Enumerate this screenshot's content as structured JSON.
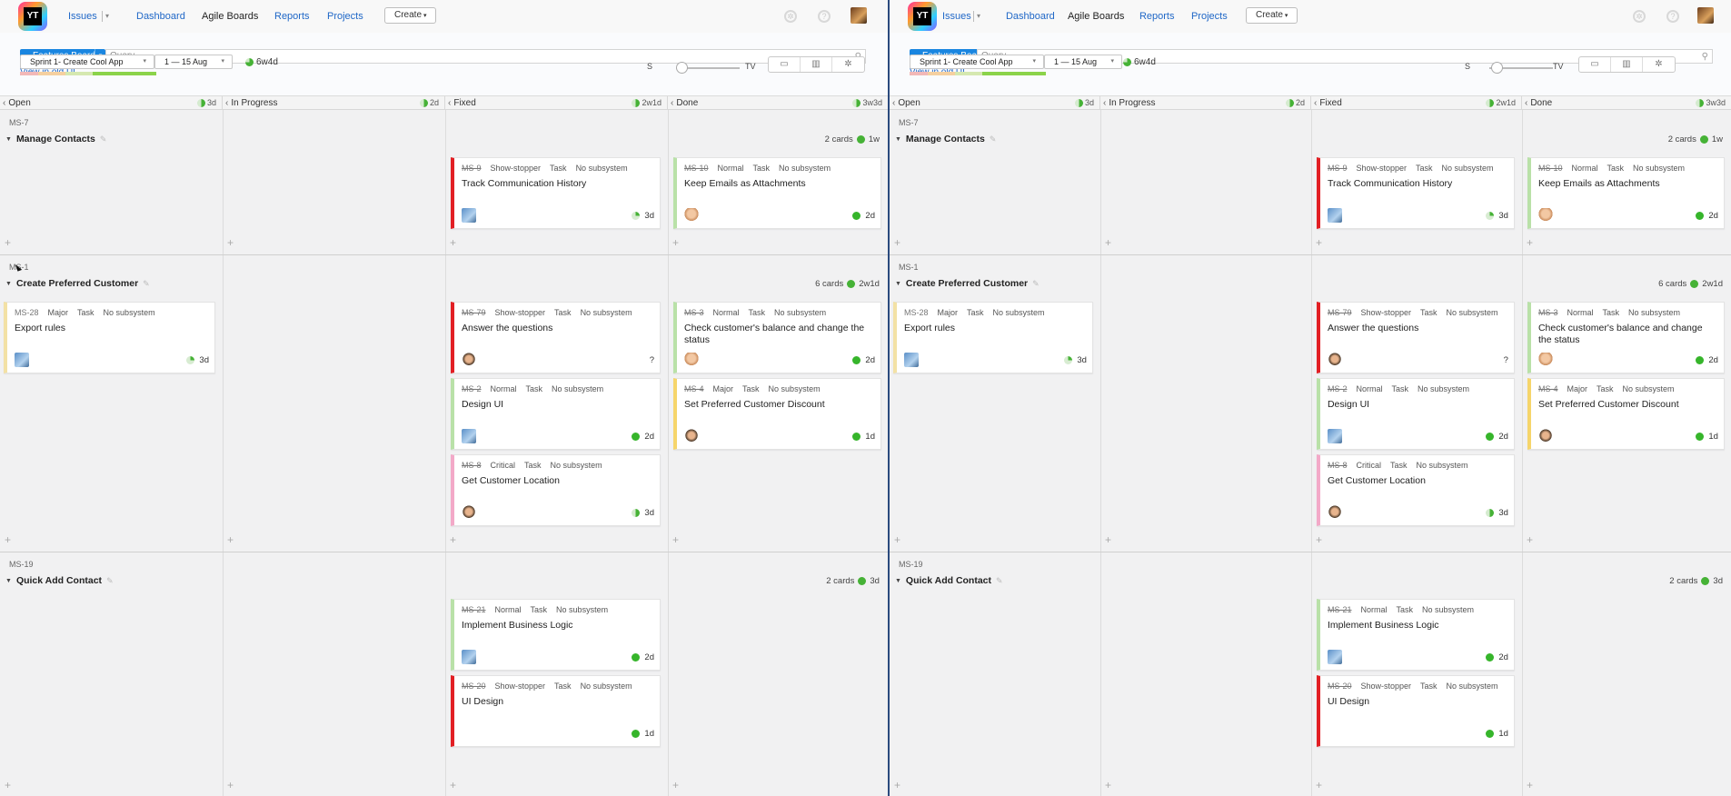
{
  "nav": {
    "logo_text": "YT",
    "issues": "Issues",
    "dashboard": "Dashboard",
    "agile_boards": "Agile Boards",
    "reports": "Reports",
    "projects": "Projects",
    "create": "Create",
    "settings_icon": "gear-icon",
    "help_icon": "help-icon"
  },
  "toolbar": {
    "board_name": "Features Board",
    "query_placeholder": "Query",
    "view_old_ui": "View in old UI",
    "sprint": "Sprint 1- Create Cool App",
    "dates": "1 — 15 Aug",
    "sprint_estimate": "6w4d",
    "slider_min": "S",
    "slider_max": "TV"
  },
  "columns": [
    {
      "name": "Open",
      "time": "3d"
    },
    {
      "name": "In Progress",
      "time": "2d"
    },
    {
      "name": "Fixed",
      "time": "2w1d"
    },
    {
      "name": "Done",
      "time": "3w3d"
    }
  ],
  "swimlanes": [
    {
      "id": "MS-7",
      "title": "Manage Contacts",
      "count": "2 cards",
      "estimate": "1w",
      "cards": [
        {
          "col": 2,
          "row": 0,
          "id": "MS-9",
          "priority": "Show-stopper",
          "type": "Task",
          "subsystem": "No subsystem",
          "title": "Track Communication History",
          "estimate": "3d",
          "color": "red",
          "avatar": "a1",
          "progress": "quarter"
        },
        {
          "col": 3,
          "row": 0,
          "id": "MS-10",
          "priority": "Normal",
          "type": "Task",
          "subsystem": "No subsystem",
          "title": "Keep Emails as Attachments",
          "estimate": "2d",
          "color": "green",
          "avatar": "a2",
          "progress": "full"
        }
      ]
    },
    {
      "id": "MS-1",
      "title": "Create Preferred Customer",
      "count": "6 cards",
      "estimate": "2w1d",
      "cards": [
        {
          "col": 0,
          "row": 0,
          "id": "MS-28",
          "priority": "Major",
          "type": "Task",
          "subsystem": "No subsystem",
          "title": "Export rules",
          "estimate": "3d",
          "color": "cream",
          "avatar": "a1",
          "progress": "quarter",
          "open": true
        },
        {
          "col": 2,
          "row": 0,
          "id": "MS-79",
          "priority": "Show-stopper",
          "type": "Task",
          "subsystem": "No subsystem",
          "title": "Answer the questions",
          "estimate": "?",
          "color": "red",
          "avatar": "a3",
          "progress": "none"
        },
        {
          "col": 2,
          "row": 1,
          "id": "MS-2",
          "priority": "Normal",
          "type": "Task",
          "subsystem": "No subsystem",
          "title": "Design UI",
          "estimate": "2d",
          "color": "green",
          "avatar": "a1",
          "progress": "full"
        },
        {
          "col": 2,
          "row": 2,
          "id": "MS-8",
          "priority": "Critical",
          "type": "Task",
          "subsystem": "No subsystem",
          "title": "Get Customer Location",
          "estimate": "3d",
          "color": "pink",
          "avatar": "a3",
          "progress": "half"
        },
        {
          "col": 3,
          "row": 0,
          "id": "MS-3",
          "priority": "Normal",
          "type": "Task",
          "subsystem": "No subsystem",
          "title": "Check customer's balance and change the status",
          "estimate": "2d",
          "color": "green",
          "avatar": "a2",
          "progress": "full"
        },
        {
          "col": 3,
          "row": 1,
          "id": "MS-4",
          "priority": "Major",
          "type": "Task",
          "subsystem": "No subsystem",
          "title": "Set Preferred Customer Discount",
          "estimate": "1d",
          "color": "yellow",
          "avatar": "a3",
          "progress": "full"
        }
      ]
    },
    {
      "id": "MS-19",
      "title": "Quick Add Contact",
      "count": "2 cards",
      "estimate": "3d",
      "cards": [
        {
          "col": 2,
          "row": 0,
          "id": "MS-21",
          "priority": "Normal",
          "type": "Task",
          "subsystem": "No subsystem",
          "title": "Implement Business Logic",
          "estimate": "2d",
          "color": "green",
          "avatar": "a1",
          "progress": "full"
        },
        {
          "col": 2,
          "row": 1,
          "id": "MS-20",
          "priority": "Show-stopper",
          "type": "Task",
          "subsystem": "No subsystem",
          "title": "UI Design",
          "estimate": "1d",
          "color": "red",
          "avatar": "none",
          "progress": "full"
        }
      ]
    }
  ]
}
